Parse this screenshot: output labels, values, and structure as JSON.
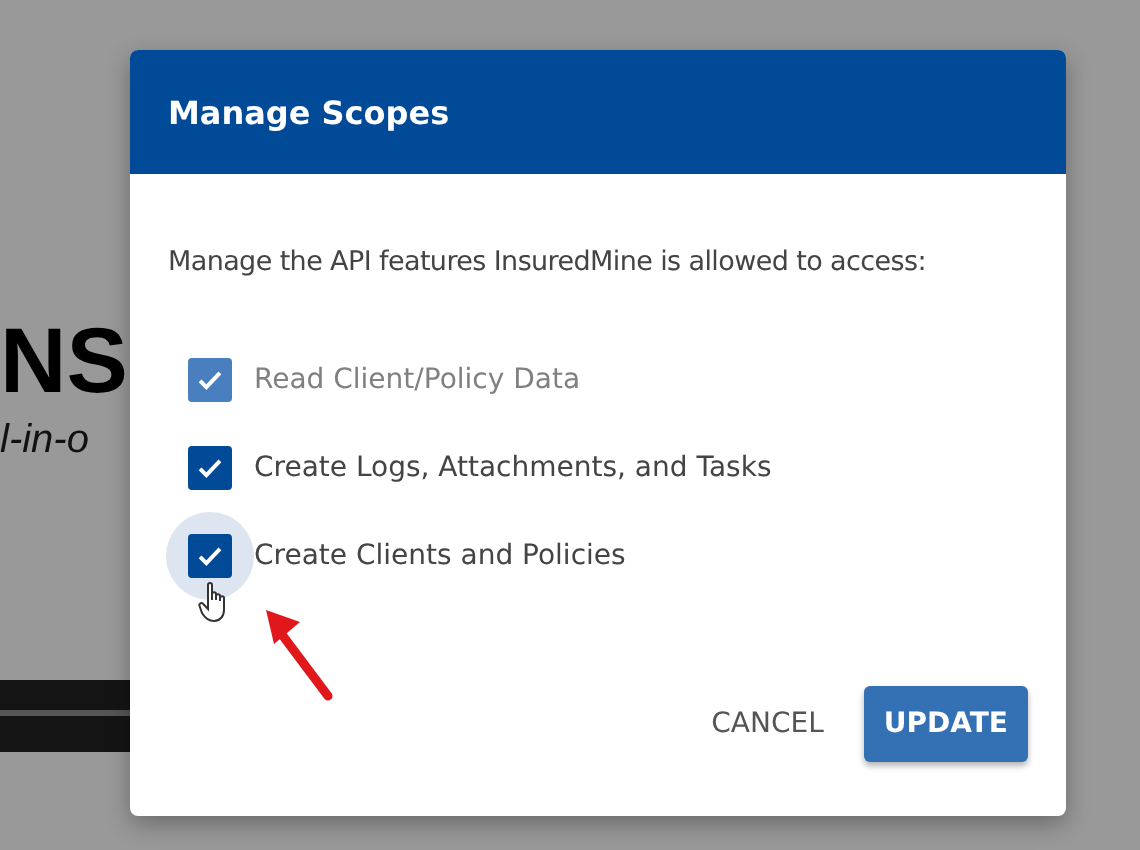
{
  "background": {
    "heading": "NS",
    "tagline": "l-in-o"
  },
  "dialog": {
    "title": "Manage Scopes",
    "description": "Manage the API features InsuredMine is allowed to access:",
    "scopes": [
      {
        "label": "Read Client/Policy Data",
        "checked": true,
        "disabled": true,
        "focused": false
      },
      {
        "label": "Create Logs, Attachments, and Tasks",
        "checked": true,
        "disabled": false,
        "focused": false
      },
      {
        "label": "Create Clients and Policies",
        "checked": true,
        "disabled": false,
        "focused": true
      }
    ],
    "buttons": [
      {
        "label": "CANCEL",
        "kind": "text"
      },
      {
        "label": "UPDATE",
        "kind": "primary"
      }
    ]
  }
}
